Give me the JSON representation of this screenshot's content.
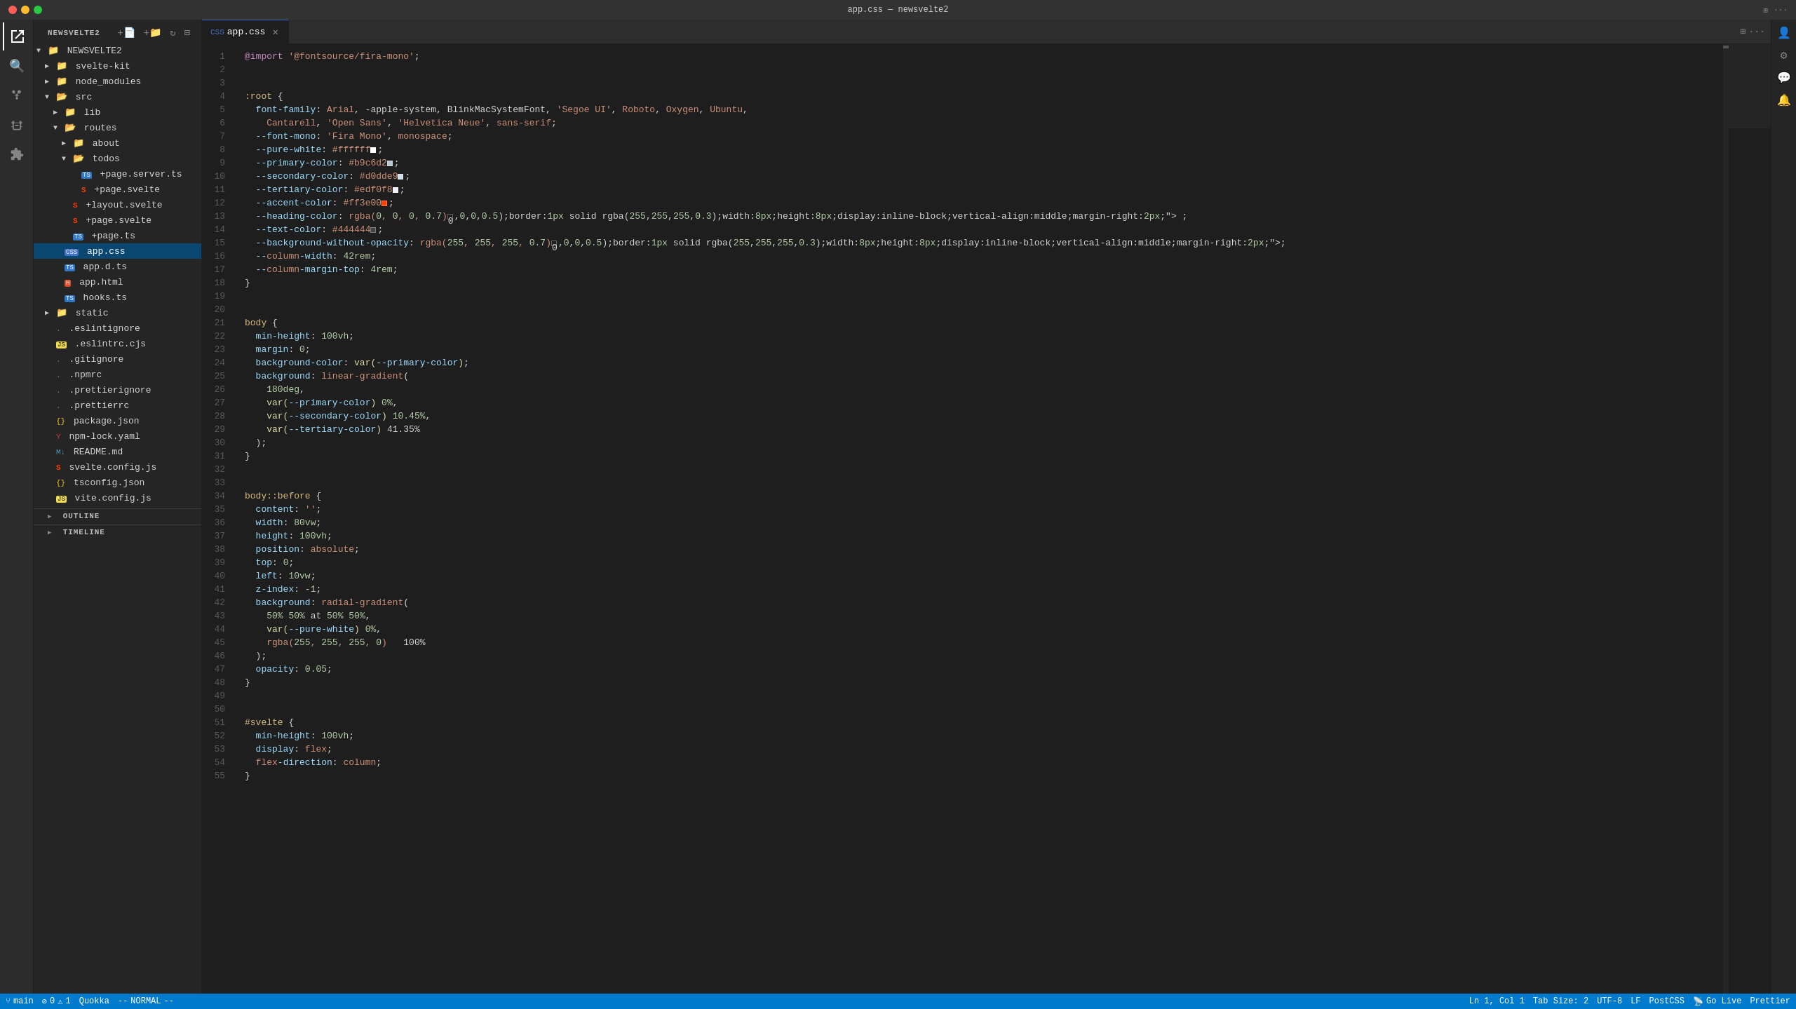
{
  "titleBar": {
    "title": "app.css — newsvelte2",
    "tabTitle": "app.css",
    "tabFile": "app.css"
  },
  "sidebar": {
    "title": "NEWSVELTE2",
    "tree": [
      {
        "id": "newsvelte2",
        "name": "NEWSVELTE2",
        "type": "folder",
        "depth": 0,
        "open": true,
        "arrow": "▼"
      },
      {
        "id": "svelte-kit",
        "name": "svelte-kit",
        "type": "folder",
        "depth": 1,
        "open": false,
        "arrow": "▶"
      },
      {
        "id": "node_modules",
        "name": "node_modules",
        "type": "folder",
        "depth": 1,
        "open": false,
        "arrow": "▶"
      },
      {
        "id": "src",
        "name": "src",
        "type": "folder-open",
        "depth": 1,
        "open": true,
        "arrow": "▼"
      },
      {
        "id": "lib",
        "name": "lib",
        "type": "folder",
        "depth": 2,
        "open": false,
        "arrow": "▶"
      },
      {
        "id": "routes",
        "name": "routes",
        "type": "folder-open",
        "depth": 2,
        "open": true,
        "arrow": "▼"
      },
      {
        "id": "about",
        "name": "about",
        "type": "folder",
        "depth": 3,
        "open": false,
        "arrow": "▶"
      },
      {
        "id": "todos",
        "name": "todos",
        "type": "folder-open",
        "depth": 3,
        "open": true,
        "arrow": "▼"
      },
      {
        "id": "page-server-ts",
        "name": "+page.server.ts",
        "type": "ts",
        "depth": 4
      },
      {
        "id": "page-svelte-todos",
        "name": "+page.svelte",
        "type": "svelte",
        "depth": 4
      },
      {
        "id": "layout-svelte",
        "name": "+layout.svelte",
        "type": "svelte",
        "depth": 3
      },
      {
        "id": "page-svelte",
        "name": "+page.svelte",
        "type": "svelte",
        "depth": 3
      },
      {
        "id": "page-ts",
        "name": "+page.ts",
        "type": "ts",
        "depth": 3
      },
      {
        "id": "app-css",
        "name": "app.css",
        "type": "css",
        "depth": 2,
        "selected": true
      },
      {
        "id": "app-d-ts",
        "name": "app.d.ts",
        "type": "ts",
        "depth": 2
      },
      {
        "id": "app-html",
        "name": "app.html",
        "type": "html",
        "depth": 2
      },
      {
        "id": "hooks-ts",
        "name": "hooks.ts",
        "type": "ts",
        "depth": 2
      },
      {
        "id": "static",
        "name": "static",
        "type": "folder",
        "depth": 1,
        "open": false,
        "arrow": "▶"
      },
      {
        "id": "eslintignore",
        "name": ".eslintignore",
        "type": "ignore",
        "depth": 1
      },
      {
        "id": "eslintrc",
        "name": ".eslintrc.cjs",
        "type": "js",
        "depth": 1
      },
      {
        "id": "gitignore",
        "name": ".gitignore",
        "type": "ignore",
        "depth": 1
      },
      {
        "id": "npmrc",
        "name": ".npmrc",
        "type": "ignore",
        "depth": 1
      },
      {
        "id": "prettierignore",
        "name": ".prettierignore",
        "type": "ignore",
        "depth": 1
      },
      {
        "id": "prettierrc",
        "name": ".prettierrc",
        "type": "ignore",
        "depth": 1
      },
      {
        "id": "package-json",
        "name": "package.json",
        "type": "json",
        "depth": 1
      },
      {
        "id": "npm-lock-yaml",
        "name": "npm-lock.yaml",
        "type": "yaml",
        "depth": 1
      },
      {
        "id": "readme-md",
        "name": "README.md",
        "type": "md",
        "depth": 1
      },
      {
        "id": "svelte-config-js",
        "name": "svelte.config.js",
        "type": "svelte",
        "depth": 1
      },
      {
        "id": "tsconfig-json",
        "name": "tsconfig.json",
        "type": "json",
        "depth": 1
      },
      {
        "id": "vite-config-js",
        "name": "vite.config.js",
        "type": "js",
        "depth": 1
      }
    ]
  },
  "editor": {
    "filename": "app.css",
    "lines": [
      {
        "n": 1,
        "code": "@import '@fontsource/fira-mono';"
      },
      {
        "n": 2,
        "code": ""
      },
      {
        "n": 3,
        "code": ""
      },
      {
        "n": 4,
        "code": ":root {"
      },
      {
        "n": 5,
        "code": "  font-family: Arial, -apple-system, BlinkMacSystemFont, 'Segoe UI', Roboto, Oxygen, Ubuntu,"
      },
      {
        "n": 6,
        "code": "    Cantarell, 'Open Sans', 'Helvetica Neue', sans-serif;"
      },
      {
        "n": 7,
        "code": "  --font-mono: 'Fira Mono', monospace;"
      },
      {
        "n": 8,
        "code": "  --pure-white: #ffffff■;"
      },
      {
        "n": 9,
        "code": "  --primary-color: #b9c6d2■;"
      },
      {
        "n": 10,
        "code": "  --secondary-color: #d0dde9■;"
      },
      {
        "n": 11,
        "code": "  --tertiary-color: #edf0f8■;"
      },
      {
        "n": 12,
        "code": "  --accent-color: #ff3e00■;"
      },
      {
        "n": 13,
        "code": "  --heading-color: rgba(0, 0, 0, 0.7)■ ;"
      },
      {
        "n": 14,
        "code": "  --text-color: #444444■;"
      },
      {
        "n": 15,
        "code": "  --background-without-opacity: rgba(255, 255, 255, 0.7)■;"
      },
      {
        "n": 16,
        "code": "  --column-width: 42rem;"
      },
      {
        "n": 17,
        "code": "  --column-margin-top: 4rem;"
      },
      {
        "n": 18,
        "code": "}"
      },
      {
        "n": 19,
        "code": ""
      },
      {
        "n": 20,
        "code": ""
      },
      {
        "n": 21,
        "code": "body {"
      },
      {
        "n": 22,
        "code": "  min-height: 100vh;"
      },
      {
        "n": 23,
        "code": "  margin: 0;"
      },
      {
        "n": 24,
        "code": "  background-color: var(--primary-color);"
      },
      {
        "n": 25,
        "code": "  background: linear-gradient("
      },
      {
        "n": 26,
        "code": "    180deg,"
      },
      {
        "n": 27,
        "code": "    var(--primary-color) 0%,"
      },
      {
        "n": 28,
        "code": "    var(--secondary-color) 10.45%,"
      },
      {
        "n": 29,
        "code": "    var(--tertiary-color) 41.35%"
      },
      {
        "n": 30,
        "code": "  );"
      },
      {
        "n": 31,
        "code": "}"
      },
      {
        "n": 32,
        "code": ""
      },
      {
        "n": 33,
        "code": ""
      },
      {
        "n": 34,
        "code": "body::before {"
      },
      {
        "n": 35,
        "code": "  content: '';"
      },
      {
        "n": 36,
        "code": "  width: 80vw;"
      },
      {
        "n": 37,
        "code": "  height: 100vh;"
      },
      {
        "n": 38,
        "code": "  position: absolute;"
      },
      {
        "n": 39,
        "code": "  top: 0;"
      },
      {
        "n": 40,
        "code": "  left: 10vw;"
      },
      {
        "n": 41,
        "code": "  z-index: -1;"
      },
      {
        "n": 42,
        "code": "  background: radial-gradient("
      },
      {
        "n": 43,
        "code": "    50% 50% at 50% 50%,"
      },
      {
        "n": 44,
        "code": "    var(--pure-white) 0%,"
      },
      {
        "n": 45,
        "code": "    rgba(255, 255, 255, 0)   100%"
      },
      {
        "n": 46,
        "code": "  );"
      },
      {
        "n": 47,
        "code": "  opacity: 0.05;"
      },
      {
        "n": 48,
        "code": "}"
      },
      {
        "n": 49,
        "code": ""
      },
      {
        "n": 50,
        "code": ""
      },
      {
        "n": 51,
        "code": "#svelte {"
      },
      {
        "n": 52,
        "code": "  min-height: 100vh;"
      },
      {
        "n": 53,
        "code": "  display: flex;"
      },
      {
        "n": 54,
        "code": "  flex-direction: column;"
      },
      {
        "n": 55,
        "code": "}"
      }
    ]
  },
  "statusBar": {
    "branch": "main",
    "errors": "0",
    "warnings": "1",
    "editorName": "Quokka",
    "mode": "NORMAL",
    "position": "Ln 1, Col 1",
    "encoding": "UTF-8",
    "lineEnding": "LF",
    "language": "PostCSS",
    "liveShare": "Go Live",
    "prettier": "Prettier"
  },
  "outline": {
    "label": "OUTLINE",
    "collapsed": true
  },
  "timeline": {
    "label": "TIMELINE",
    "collapsed": true
  },
  "activityBar": {
    "icons": [
      {
        "name": "explorer-icon",
        "symbol": "⬚",
        "active": true
      },
      {
        "name": "search-icon",
        "symbol": "🔍"
      },
      {
        "name": "source-control-icon",
        "symbol": "⑂"
      },
      {
        "name": "debug-icon",
        "symbol": "▷"
      },
      {
        "name": "extensions-icon",
        "symbol": "⊞"
      }
    ]
  }
}
